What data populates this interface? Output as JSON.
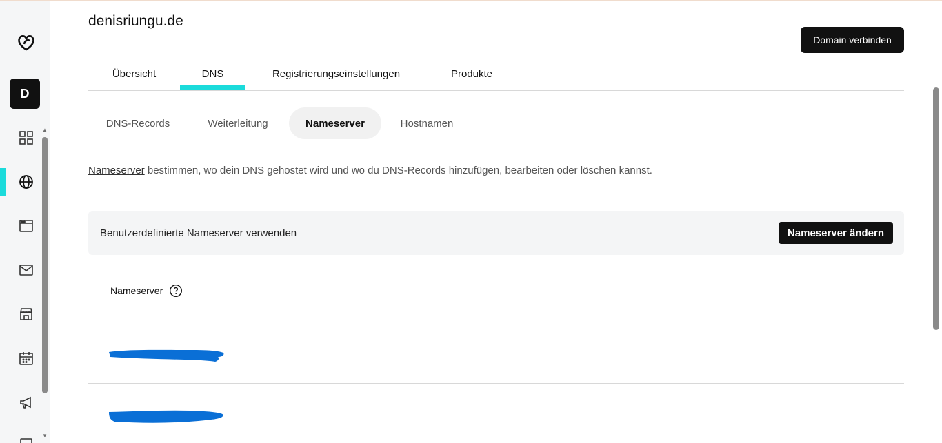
{
  "rail": {
    "avatar_letter": "D",
    "icons": [
      "logo-icon",
      "grid-icon",
      "globe-icon",
      "browser-window-icon",
      "mail-icon",
      "storefront-icon",
      "calendar-icon",
      "megaphone-icon"
    ],
    "active_color": "#1bdbdb"
  },
  "header": {
    "domain": "denisriungu.de",
    "connect_button": "Domain verbinden"
  },
  "tabs": [
    {
      "label": "Übersicht",
      "active": false
    },
    {
      "label": "DNS",
      "active": true
    },
    {
      "label": "Registrierungseinstellungen",
      "active": false
    },
    {
      "label": "Produkte",
      "active": false
    }
  ],
  "subtabs": [
    {
      "label": "DNS-Records",
      "active": false
    },
    {
      "label": "Weiterleitung",
      "active": false
    },
    {
      "label": "Nameserver",
      "active": true
    },
    {
      "label": "Hostnamen",
      "active": false
    }
  ],
  "intro": {
    "link": "Nameserver",
    "text": " bestimmen, wo dein DNS gehostet wird und wo du DNS-Records hinzufügen, bearbeiten oder löschen kannst."
  },
  "panel": {
    "label": "Benutzerdefinierte Nameserver verwenden",
    "button": "Nameserver ändern"
  },
  "list": {
    "header": "Nameserver",
    "rows": [
      "",
      ""
    ],
    "redaction_color": "#0a6fd6"
  }
}
